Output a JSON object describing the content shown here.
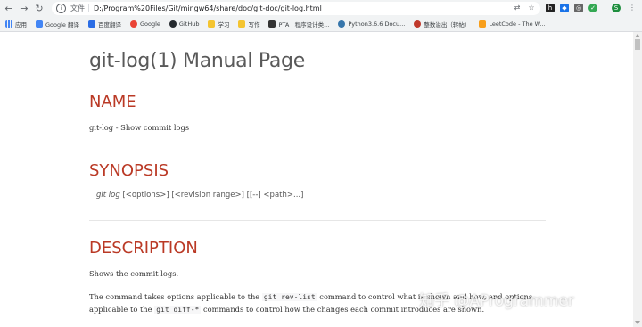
{
  "browser": {
    "url_scheme_label": "文件",
    "url": "D:/Program%20Files/Git/mingw64/share/doc/git-doc/git-log.html",
    "bookmarks": [
      {
        "label": "应用",
        "color": "#4285f4"
      },
      {
        "label": "Google 翻译",
        "color": "#4285f4"
      },
      {
        "label": "百度翻译",
        "color": "#2b6de5"
      },
      {
        "label": "Google",
        "color": "#ea4335"
      },
      {
        "label": "GitHub",
        "color": "#24292e"
      },
      {
        "label": "学习",
        "color": "#f4b400"
      },
      {
        "label": "写作",
        "color": "#f4b400"
      },
      {
        "label": "PTA | 程序设计类...",
        "color": "#333333"
      },
      {
        "label": "Python3.6.6 Docu...",
        "color": "#3776ab"
      },
      {
        "label": "整数溢出（转帖）",
        "color": "#c0392b"
      },
      {
        "label": "LeetCode - The W...",
        "color": "#f89f1b"
      }
    ]
  },
  "doc": {
    "title": "git-log(1) Manual Page",
    "name_heading": "NAME",
    "name_text": "git-log - Show commit logs",
    "synopsis_heading": "SYNOPSIS",
    "synopsis_cmd": "git log",
    "synopsis_args": " [<options>] [<revision range>] [[--] <path>...]",
    "description_heading": "DESCRIPTION",
    "desc_p1": "Shows the commit logs.",
    "desc_p2_a": "The command takes options applicable to the ",
    "desc_p2_code1": "git rev-list",
    "desc_p2_b": " command to control what is shown and how, and options",
    "desc_p3_a": "applicable to the ",
    "desc_p3_code2": "git diff-*",
    "desc_p3_b": " commands to control how the changes each commit introduces are shown."
  },
  "watermark": "知乎 @AProgrammer"
}
